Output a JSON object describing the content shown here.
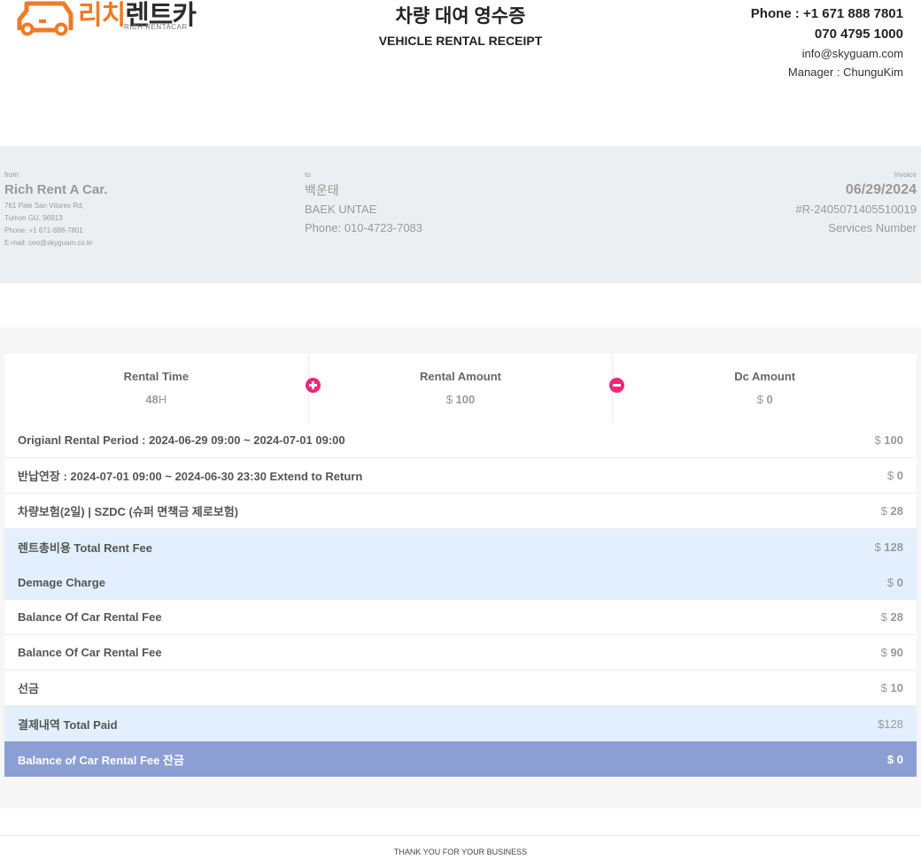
{
  "logo": {
    "korean_a": "리치",
    "korean_b": "렌트카",
    "english": "RICH RENTACAR"
  },
  "header": {
    "title_kr": "차량 대여 영수증",
    "title_en": "VEHICLE RENTAL RECEIPT",
    "phone1": "Phone : +1 671 888 7801",
    "phone2": "070 4795 1000",
    "email": "info@skyguam.com",
    "manager": "Manager : ChunguKim"
  },
  "from": {
    "label": "from",
    "name": "Rich Rent A Car.",
    "address1": "761 Pale San Vitores Rd,",
    "address2": "Tumon GU, 96913",
    "phone": "Phone: +1 671-888-7801",
    "email": "E-mail: ceo@skyguam.co.kr"
  },
  "to": {
    "label": "to",
    "name_kr": "백운태",
    "name_en": "BAEK UNTAE",
    "phone": "Phone: 010-4723-7083"
  },
  "invoice": {
    "label": "Invoice",
    "date": "06/29/2024",
    "number": "#R-2405071405510019",
    "services": "Services Number"
  },
  "summary": {
    "rental_time": {
      "label": "Rental Time",
      "value": "48",
      "unit": "H"
    },
    "rental_amount": {
      "label": "Rental Amount",
      "currency": "$",
      "value": "100"
    },
    "dc_amount": {
      "label": "Dc Amount",
      "currency": "$",
      "value": "0"
    }
  },
  "rows": [
    {
      "label": "Origianl Rental Period : 2024-06-29 09:00 ~ 2024-07-01 09:00",
      "currency": "$",
      "amount": "100"
    },
    {
      "label": "반납연장 : 2024-07-01 09:00 ~ 2024-06-30 23:30 Extend to Return",
      "currency": "$",
      "amount": "0"
    },
    {
      "label": "차량보험(2일) | SZDC (슈퍼 면책금 제로보험)",
      "currency": "$",
      "amount": "28"
    },
    {
      "label": "렌트총비용 Total Rent Fee",
      "currency": "$",
      "amount": "128"
    },
    {
      "label": "Demage Charge",
      "currency": "$",
      "amount": "0"
    },
    {
      "label": "Balance Of Car Rental Fee",
      "currency": "$",
      "amount": "28"
    },
    {
      "label": "Balance Of Car Rental Fee",
      "currency": "$",
      "amount": "90"
    },
    {
      "label": "선금",
      "currency": "$",
      "amount": "10"
    },
    {
      "label": "결제내역 Total Paid",
      "currency": "$",
      "amount": "128"
    },
    {
      "label": "Balance of Car Rental Fee 잔금",
      "currency": "$",
      "amount": "0"
    }
  ],
  "footer": {
    "thanks": "THANK YOU FOR YOUR BUSINESS"
  },
  "colors": {
    "brand_orange": "#f07a25",
    "accent_pink": "#f0267a",
    "highlight_blue": "#e3effc",
    "total_blue": "#8c9fd5",
    "band_gray": "#eceff1"
  },
  "icons": {
    "plus": "plus-circle-icon",
    "minus": "minus-circle-icon",
    "logo": "car-outline-icon"
  }
}
